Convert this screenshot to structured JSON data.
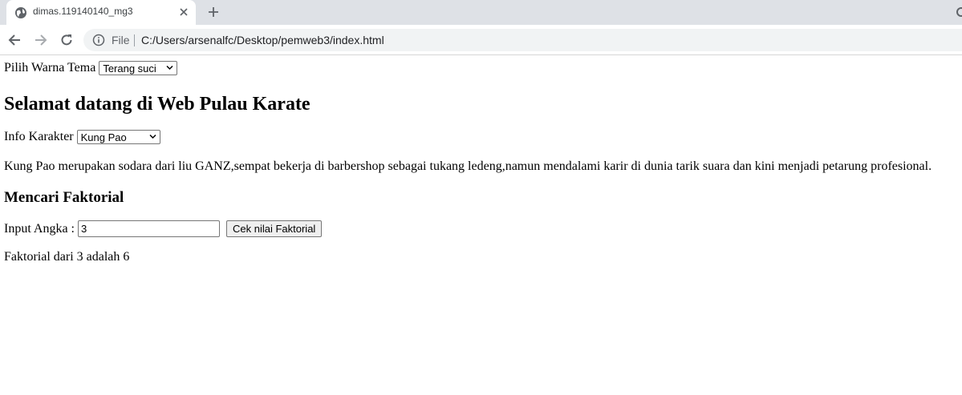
{
  "browser": {
    "tab_title": "dimas.119140140_mg3",
    "address": {
      "security_label": "File",
      "url": "C:/Users/arsenalfc/Desktop/pemweb3/index.html"
    }
  },
  "page": {
    "theme": {
      "label": "Pilih Warna Tema",
      "selected": "Terang suci"
    },
    "heading": "Selamat datang di Web Pulau Karate",
    "character": {
      "label": "Info Karakter",
      "selected": "Kung Pao"
    },
    "description": "Kung Pao merupakan sodara dari liu GANZ,sempat bekerja di barbershop sebagai tukang ledeng,namun mendalami karir di dunia tarik suara dan kini menjadi petarung profesional.",
    "factorial": {
      "heading": "Mencari Faktorial",
      "input_label": "Input Angka :",
      "input_value": "3",
      "button_label": "Cek nilai Faktorial",
      "result": "Faktorial dari 3 adalah 6"
    }
  }
}
